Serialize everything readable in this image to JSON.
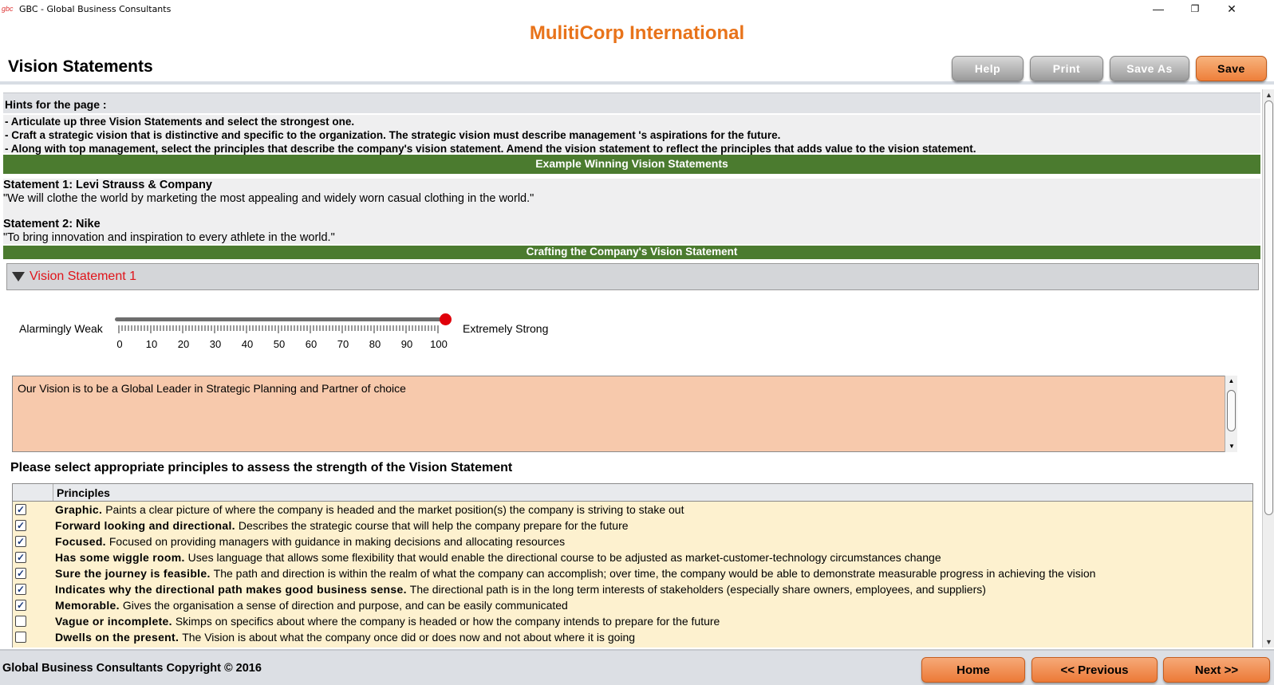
{
  "window": {
    "icon_text": "gbc",
    "title": "GBC - Global Business Consultants",
    "minimize": "—",
    "restore": "❐",
    "close": "✕"
  },
  "header": {
    "company": "MulitiCorp International",
    "page_title": "Vision Statements",
    "buttons": {
      "help": "Help",
      "print": "Print",
      "save_as": "Save As",
      "save": "Save"
    }
  },
  "hints": {
    "heading": "Hints for the page :",
    "lines": [
      "- Articulate up three Vision Statements and select the strongest one.",
      "- Craft a strategic vision that is distinctive and specific to the organization. The strategic vision must describe management 's aspirations for the future.",
      "- Along with top management, select the principles that describe the company's vision statement. Amend the vision statement to reflect the principles that adds value to the vision statement."
    ]
  },
  "examples": {
    "banner": "Example Winning Vision Statements",
    "s1_title": "Statement 1: Levi Strauss & Company",
    "s1_text": "\"We will clothe the world by marketing the most appealing and widely worn casual clothing in the world.\"",
    "s2_title": "Statement 2: Nike",
    "s2_text": "\"To bring innovation and inspiration to every athlete in the world.\""
  },
  "crafting": {
    "banner": "Crafting the Company's Vision Statement",
    "section_label": "Vision Statement 1",
    "slider": {
      "min_label": "Alarmingly Weak",
      "max_label": "Extremely Strong",
      "ticks": [
        "0",
        "10",
        "20",
        "30",
        "40",
        "50",
        "60",
        "70",
        "80",
        "90",
        "100"
      ],
      "value": 100
    },
    "statement_text": "Our Vision is to be a Global Leader in Strategic Planning and Partner of choice"
  },
  "principles": {
    "question": "Please select appropriate principles to assess the strength of the Vision Statement",
    "column_header": "Principles",
    "rows": [
      {
        "checked": true,
        "title": "Graphic.",
        "desc": "Paints a clear picture of where the company is headed and the market position(s) the company is striving to stake out"
      },
      {
        "checked": true,
        "title": "Forward looking and directional.",
        "desc": "Describes the strategic course that will help the company prepare for the future"
      },
      {
        "checked": true,
        "title": "Focused.",
        "desc": "Focused on providing managers with guidance in making decisions and allocating resources"
      },
      {
        "checked": true,
        "title": "Has some wiggle room.",
        "desc": "Uses language that allows some flexibility that would enable the directional course to be adjusted as market-customer-technology circumstances change"
      },
      {
        "checked": true,
        "title": "Sure the journey is feasible.",
        "desc": "The path and direction is within the realm of what the company can accomplish; over time, the company would be able to demonstrate measurable progress in achieving the vision"
      },
      {
        "checked": true,
        "title": "Indicates why the directional path makes good business sense.",
        "desc": "The directional path is in the long term interests of stakeholders (especially share owners, employees, and suppliers)"
      },
      {
        "checked": true,
        "title": "Memorable.",
        "desc": "Gives the organisation a sense of direction and purpose, and can be easily communicated"
      },
      {
        "checked": false,
        "title": "Vague or incomplete.",
        "desc": "Skimps on specifics about where the company is headed or how the company intends to prepare for the future"
      },
      {
        "checked": false,
        "title": "Dwells on the present.",
        "desc": "The Vision is about what the company once did or does now and not about where it is going"
      }
    ]
  },
  "footer": {
    "copyright": "Global Business Consultants Copyright © 2016",
    "home": "Home",
    "previous": "<< Previous",
    "next": "Next >>"
  }
}
